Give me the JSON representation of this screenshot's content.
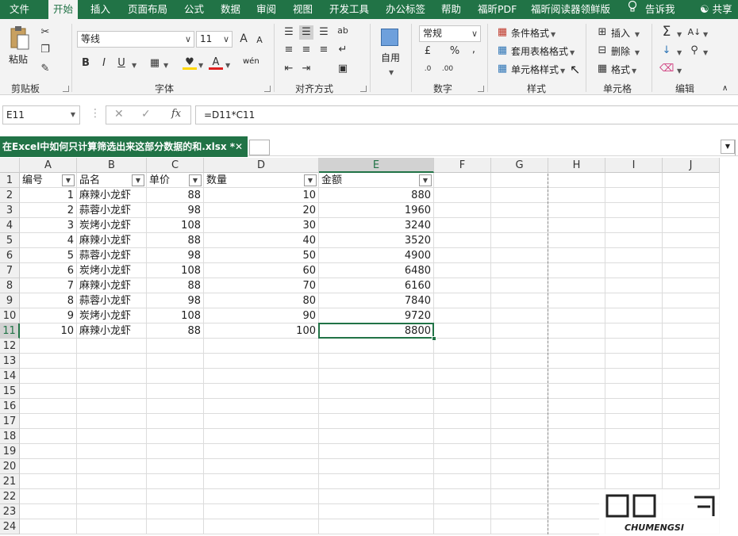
{
  "tabs": [
    "文件",
    "开始",
    "插入",
    "页面布局",
    "公式",
    "数据",
    "审阅",
    "视图",
    "开发工具",
    "办公标签",
    "帮助",
    "福昕PDF",
    "福昕阅读器领鲜版"
  ],
  "tell_me": "告诉我",
  "share": "共享",
  "ribbon": {
    "clipboard": {
      "paste": "粘贴",
      "label": "剪贴板"
    },
    "font": {
      "name": "等线",
      "size": "11",
      "label": "字体",
      "bold": "B",
      "italic": "I",
      "underline": "U",
      "grow": "A",
      "shrink": "A",
      "font_color": "A",
      "phonetic": "wén"
    },
    "alignment": {
      "label": "对齐方式"
    },
    "wrap": {
      "label": "自用"
    },
    "number": {
      "format": "常规",
      "percent": "%",
      "comma": ",",
      "label": "数字"
    },
    "styles": {
      "cond": "条件格式",
      "table": "套用表格格式",
      "cell": "单元格样式",
      "label": "样式"
    },
    "cells": {
      "insert": "插入",
      "delete": "删除",
      "format": "格式",
      "label": "单元格"
    },
    "editing": {
      "label": "编辑"
    }
  },
  "formula_bar": {
    "name_box": "E11",
    "cancel": "✕",
    "enter": "✓",
    "fx": "fx",
    "formula": "=D11*C11"
  },
  "document": {
    "title": "在Excel中如何只计算筛选出来这部分数据的和.xlsx *",
    "close": "✕"
  },
  "columns": [
    "A",
    "B",
    "C",
    "D",
    "E",
    "F",
    "G",
    "H",
    "I",
    "J"
  ],
  "rows": [
    "1",
    "2",
    "3",
    "4",
    "5",
    "6",
    "7",
    "8",
    "9",
    "10",
    "11",
    "12",
    "13",
    "14",
    "15",
    "16",
    "17",
    "18",
    "19",
    "20",
    "21",
    "22",
    "23",
    "24"
  ],
  "headers": [
    "编号",
    "品名",
    "单价",
    "数量",
    "金额"
  ],
  "table": [
    [
      "1",
      "麻辣小龙虾",
      "88",
      "10",
      "880"
    ],
    [
      "2",
      "蒜蓉小龙虾",
      "98",
      "20",
      "1960"
    ],
    [
      "3",
      "炭烤小龙虾",
      "108",
      "30",
      "3240"
    ],
    [
      "4",
      "麻辣小龙虾",
      "88",
      "40",
      "3520"
    ],
    [
      "5",
      "蒜蓉小龙虾",
      "98",
      "50",
      "4900"
    ],
    [
      "6",
      "炭烤小龙虾",
      "108",
      "60",
      "6480"
    ],
    [
      "7",
      "麻辣小龙虾",
      "88",
      "70",
      "6160"
    ],
    [
      "8",
      "蒜蓉小龙虾",
      "98",
      "80",
      "7840"
    ],
    [
      "9",
      "炭烤小龙虾",
      "108",
      "90",
      "9720"
    ],
    [
      "10",
      "麻辣小龙虾",
      "88",
      "100",
      "8800"
    ]
  ],
  "selected_cell": "E11",
  "watermark": "CHUMENGSI",
  "colors": {
    "accent": "#217346",
    "grid": "#dcdcdc",
    "header_bg": "#f0f0f0"
  }
}
